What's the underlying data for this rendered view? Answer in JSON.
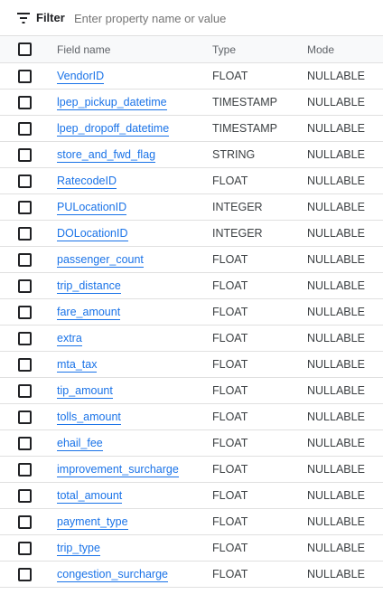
{
  "filter": {
    "label": "Filter",
    "placeholder": "Enter property name or value",
    "value": ""
  },
  "table": {
    "headers": {
      "name": "Field name",
      "type": "Type",
      "mode": "Mode"
    },
    "rows": [
      {
        "name": "VendorID",
        "type": "FLOAT",
        "mode": "NULLABLE"
      },
      {
        "name": "lpep_pickup_datetime",
        "type": "TIMESTAMP",
        "mode": "NULLABLE"
      },
      {
        "name": "lpep_dropoff_datetime",
        "type": "TIMESTAMP",
        "mode": "NULLABLE"
      },
      {
        "name": "store_and_fwd_flag",
        "type": "STRING",
        "mode": "NULLABLE"
      },
      {
        "name": "RatecodeID",
        "type": "FLOAT",
        "mode": "NULLABLE"
      },
      {
        "name": "PULocationID",
        "type": "INTEGER",
        "mode": "NULLABLE"
      },
      {
        "name": "DOLocationID",
        "type": "INTEGER",
        "mode": "NULLABLE"
      },
      {
        "name": "passenger_count",
        "type": "FLOAT",
        "mode": "NULLABLE"
      },
      {
        "name": "trip_distance",
        "type": "FLOAT",
        "mode": "NULLABLE"
      },
      {
        "name": "fare_amount",
        "type": "FLOAT",
        "mode": "NULLABLE"
      },
      {
        "name": "extra",
        "type": "FLOAT",
        "mode": "NULLABLE"
      },
      {
        "name": "mta_tax",
        "type": "FLOAT",
        "mode": "NULLABLE"
      },
      {
        "name": "tip_amount",
        "type": "FLOAT",
        "mode": "NULLABLE"
      },
      {
        "name": "tolls_amount",
        "type": "FLOAT",
        "mode": "NULLABLE"
      },
      {
        "name": "ehail_fee",
        "type": "FLOAT",
        "mode": "NULLABLE"
      },
      {
        "name": "improvement_surcharge",
        "type": "FLOAT",
        "mode": "NULLABLE"
      },
      {
        "name": "total_amount",
        "type": "FLOAT",
        "mode": "NULLABLE"
      },
      {
        "name": "payment_type",
        "type": "FLOAT",
        "mode": "NULLABLE"
      },
      {
        "name": "trip_type",
        "type": "FLOAT",
        "mode": "NULLABLE"
      },
      {
        "name": "congestion_surcharge",
        "type": "FLOAT",
        "mode": "NULLABLE"
      }
    ]
  },
  "colors": {
    "link": "#1a73e8",
    "text": "#202124",
    "muted": "#5f6368",
    "divider": "#e0e0e0",
    "header_bg": "#f8f9fa"
  },
  "icons": {
    "filter": "filter-icon",
    "checkbox": "checkbox-unchecked"
  }
}
